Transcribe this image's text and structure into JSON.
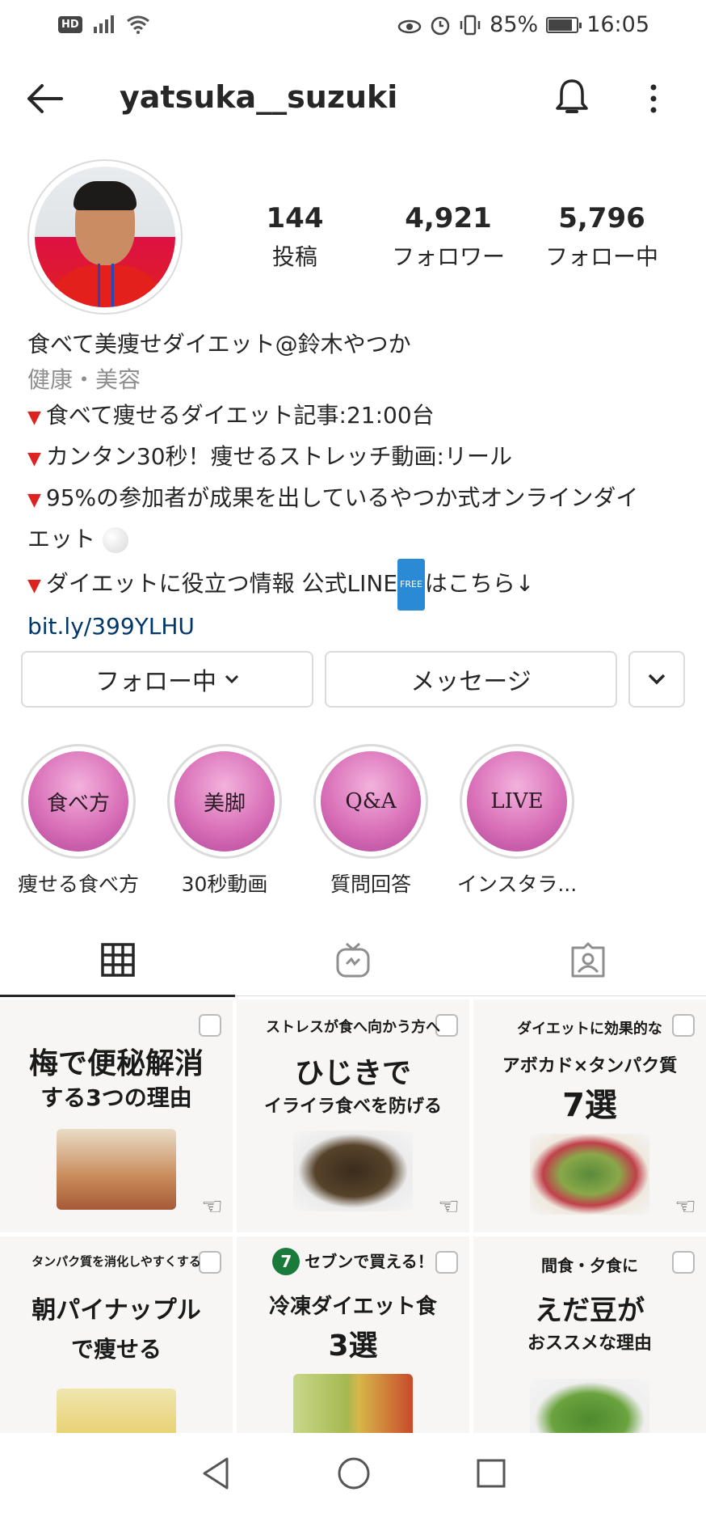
{
  "status_bar": {
    "hd": "HD",
    "battery_percent": "85%",
    "battery_level": 0.85,
    "time": "16:05"
  },
  "header": {
    "username": "yatsuka__suzuki"
  },
  "stats": {
    "posts_count": "144",
    "posts_label": "投稿",
    "followers_count": "4,921",
    "followers_label": "フォロワー",
    "following_count": "5,796",
    "following_label": "フォロー中"
  },
  "bio": {
    "name": "食べて美痩せダイエット@鈴木やつか",
    "category": "健康・美容",
    "line1": "食べて痩せるダイエット記事:21:00台",
    "line2": "カンタン30秒！痩せるストレッチ動画:リール",
    "line3a": "95%の参加者が成果を出しているやつか式オンラインダイ",
    "line3b": "エット",
    "line4a": "ダイエットに役立つ情報 公式LINE",
    "free_badge": "FREE",
    "line4b": "はこちら↓",
    "link": "bit.ly/399YLHU"
  },
  "buttons": {
    "following": "フォロー中",
    "message": "メッセージ"
  },
  "highlights": [
    {
      "cover": "食べ方",
      "label": "痩せる食べ方"
    },
    {
      "cover": "美脚",
      "label": "30秒動画"
    },
    {
      "cover": "Q&A",
      "label": "質問回答"
    },
    {
      "cover": "LIVE",
      "label": "インスタラ..."
    }
  ],
  "tabs": [
    "grid-icon",
    "igtv-icon",
    "tagged-icon"
  ],
  "posts": [
    {
      "l1": "梅で便秘解消",
      "l2": "する3つの理由"
    },
    {
      "l1": "ストレスが食へ向かう方へ",
      "l2": "ひじきで",
      "l3": "イライラ食べを防げる"
    },
    {
      "l1": "ダイエットに効果的な",
      "l2": "アボカド×タンパク質",
      "l3": "7選"
    },
    {
      "l1": "タンパク質を消化しやすくする",
      "l2": "朝パイナップル",
      "l3": "で痩せる"
    },
    {
      "seven": "7",
      "l1": "セブンで買える！",
      "l2": "冷凍ダイエット食",
      "l3": "3選"
    },
    {
      "l1": "間食・夕食に",
      "l2": "えだ豆が",
      "l3": "おススメな理由"
    }
  ],
  "colors": {
    "text": "#262626",
    "secondary": "#8e8e8e",
    "link": "#00376b",
    "border": "#dbdbdb",
    "highlight_pink": "#d970b8"
  }
}
